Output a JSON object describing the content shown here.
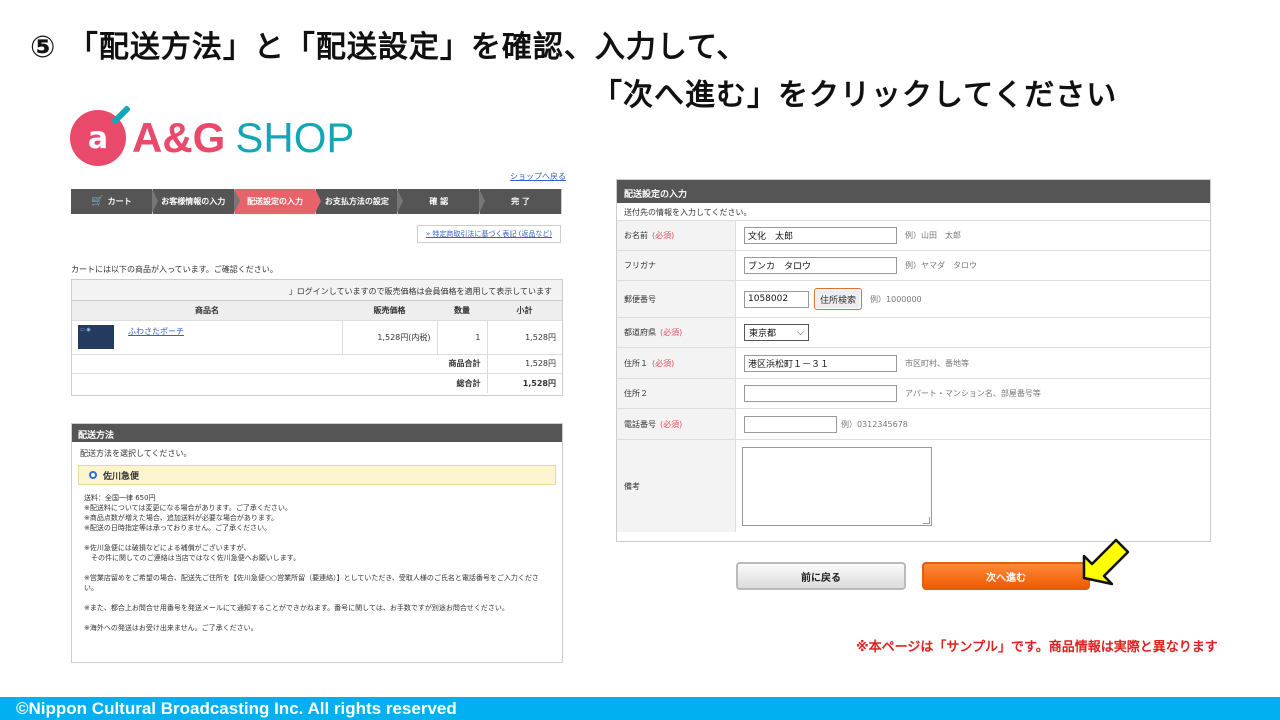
{
  "slide": {
    "title_line1": "⑤ 「配送方法」と「配送設定」を確認、入力して、",
    "title_line2": "「次へ進む」をクリックしてください",
    "sample_note": "※本ページは「サンプル」です。商品情報は実際と異なります",
    "footer": "©Nippon Cultural Broadcasting Inc. All rights reserved"
  },
  "logo": {
    "badge": "a",
    "ag": "A&G",
    "shop": "SHOP"
  },
  "shop": {
    "back_link": "ショップへ戻る",
    "steps": [
      "カート",
      "お客様情報の入力",
      "配送設定の入力",
      "お支払方法の設定",
      "確 認",
      "完 了"
    ],
    "law_link": "» 特定商取引法に基づく表記 (返品など)",
    "cart_note": "カートには以下の商品が入っています。ご確認ください。",
    "login_note": "」ログインしていますので販売価格は会員価格を適用して表示しています",
    "table_headers": {
      "name": "商品名",
      "price": "販売価格",
      "qty": "数量",
      "subtotal": "小計"
    },
    "item": {
      "name": "ふわさたポーチ",
      "price": "1,528円(内税)",
      "qty": "1",
      "subtotal": "1,528円"
    },
    "goods_total_label": "商品合計",
    "goods_total": "1,528円",
    "grand_total_label": "総合計",
    "grand_total": "1,528円"
  },
  "shipping": {
    "head": "配送方法",
    "prompt": "配送方法を選択してください。",
    "option": "佐川急便",
    "notes": [
      "送料：全国一律 650円",
      "※配送料については変更になる場合があります。ご了承ください。",
      "※商品点数が増えた場合、追加送料が必要な場合があります。",
      "※配送の日時指定等は承っておりません。ご了承ください。",
      "",
      "※佐川急便には破損などによる補償がございますが、",
      "　その件に関してのご連絡は当店ではなく佐川急便へお願いします。",
      "",
      "※営業店留めをご希望の場合、配送先ご住所を【佐川急便○○営業所留（要連絡）】としていただき、受取人様のご氏名と電話番号をご入力ください。",
      "",
      "※また、都合上お問合せ用番号を発送メールにて通知することができかねます。番号に関しては、お手数ですが別途お問合せください。",
      "",
      "※海外への発送はお受け出来ません。ご了承ください。"
    ]
  },
  "form": {
    "head": "配送設定の入力",
    "prompt": "送付先の情報を入力してください。",
    "required": "(必須)",
    "name": {
      "label": "お名前",
      "value": "文化　太郎",
      "example": "例）山田　太郎"
    },
    "kana": {
      "label": "フリガナ",
      "value": "ブンカ　タロウ",
      "example": "例）ヤマダ　タロウ"
    },
    "zip": {
      "label": "郵便番号",
      "value": "1058002",
      "button": "住所検索",
      "example": "例）1000000"
    },
    "pref": {
      "label": "都道府県",
      "value": "東京都"
    },
    "addr1": {
      "label": "住所１",
      "value": "港区浜松町１－３１",
      "example": "市区町村、番地等"
    },
    "addr2": {
      "label": "住所２",
      "value": "",
      "example": "アパート・マンション名、部屋番号等"
    },
    "tel": {
      "label": "電話番号",
      "value": "",
      "example": "例）0312345678"
    },
    "memo": {
      "label": "備考",
      "value": ""
    },
    "back_button": "前に戻る",
    "next_button": "次へ進む"
  },
  "colors": {
    "accent": "#f05a00",
    "brand_pink": "#e94a6b",
    "brand_teal": "#12a7b5",
    "footer": "#00b0f0",
    "pointer": "#ffff00"
  }
}
